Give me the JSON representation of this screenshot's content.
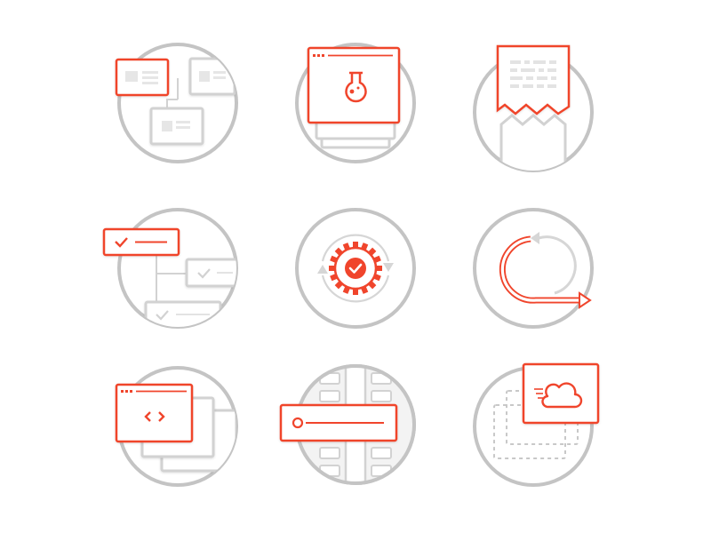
{
  "colors": {
    "accent": "#f0452c",
    "ring": "#c4c4c4",
    "line": "#d2d2d2",
    "fill_light": "#f3f3f3",
    "panel": "#ffffff"
  },
  "icons": [
    {
      "name": "org-chart-icon"
    },
    {
      "name": "experiment-window-icon"
    },
    {
      "name": "receipt-icon"
    },
    {
      "name": "checklist-tree-icon"
    },
    {
      "name": "gear-check-cycle-icon"
    },
    {
      "name": "iteration-loop-icon"
    },
    {
      "name": "code-window-icon"
    },
    {
      "name": "pipeline-input-icon"
    },
    {
      "name": "cloud-deploy-icon"
    }
  ]
}
